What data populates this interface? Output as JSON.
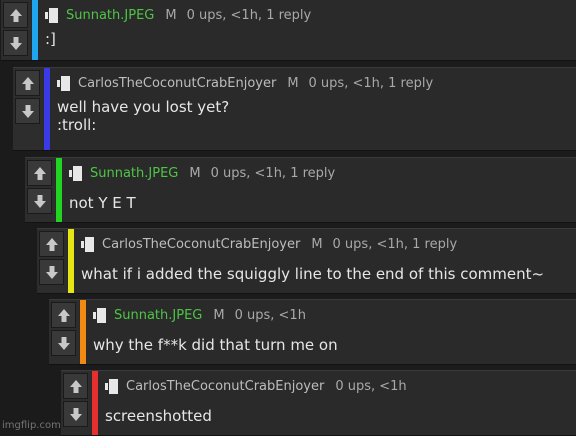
{
  "comments": [
    {
      "username": "Sunnath.JPEG",
      "badge": "M",
      "stats": "0 ups, <1h, 1 reply",
      "text": ":]",
      "bar_color": "#1ea7ef"
    },
    {
      "username": "CarlosTheCoconutCrabEnjoyer",
      "badge": "M",
      "stats": "0 ups, <1h, 1 reply",
      "text": "well have you lost yet?\n:troll:",
      "bar_color": "#3a3ae6"
    },
    {
      "username": "Sunnath.JPEG",
      "badge": "M",
      "stats": "0 ups, <1h, 1 reply",
      "text": "not Y E T",
      "bar_color": "#22d422"
    },
    {
      "username": "CarlosTheCoconutCrabEnjoyer",
      "badge": "M",
      "stats": "0 ups, <1h, 1 reply",
      "text": "what if i added the squiggly line to the end of this comment~",
      "bar_color": "#e6e614"
    },
    {
      "username": "Sunnath.JPEG",
      "badge": "M",
      "stats": "0 ups, <1h",
      "text": "why the f**k did that turn me on",
      "bar_color": "#f08a14"
    },
    {
      "username": "CarlosTheCoconutCrabEnjoyer",
      "badge": "",
      "stats": "0 ups, <1h",
      "text": "screenshotted",
      "bar_color": "#e63030"
    }
  ],
  "colors": {
    "username_green": "#4fc546",
    "username_gray": "#bdbdbd"
  },
  "icons": {
    "upvote": "arrow-up-icon",
    "downvote": "arrow-down-icon",
    "avatar": "pixel-avatar-icon"
  },
  "watermark": "imgflip.com"
}
